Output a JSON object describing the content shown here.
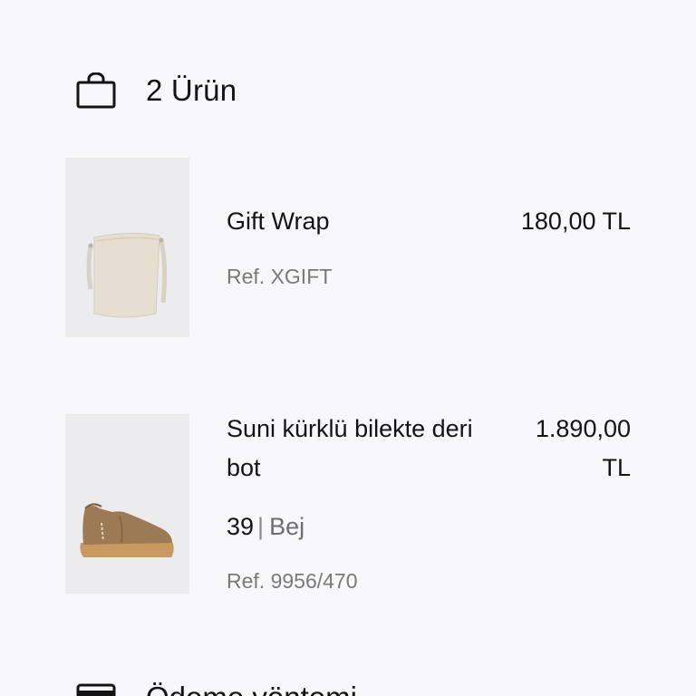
{
  "cart": {
    "count_label": "2 Ürün",
    "bag_icon": "shopping-bag-icon"
  },
  "items": [
    {
      "name": "Gift Wrap",
      "price": "180,00 TL",
      "ref": "Ref. XGIFT",
      "image_icon": "tote-bag-image"
    },
    {
      "name_line1": "Suni kürklü bilekte deri",
      "name_line2": "bot",
      "price_line1": "1.890,00",
      "price_line2": "TL",
      "size": "39",
      "separator": "|",
      "color": "Bej",
      "ref": "Ref. 9956/470",
      "image_icon": "ankle-boot-image"
    }
  ],
  "payment": {
    "title": "Ödeme yöntemi",
    "icon": "credit-card-icon"
  }
}
